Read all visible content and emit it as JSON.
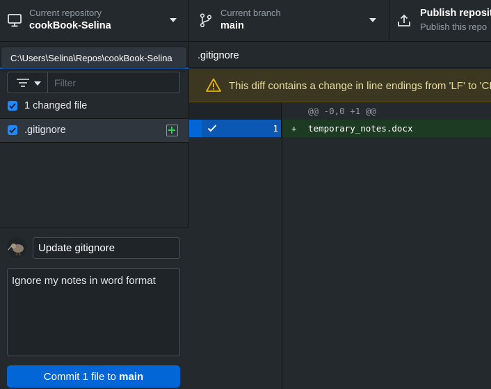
{
  "toolbar": {
    "repository": {
      "sub_label": "Current repository",
      "name": "cookBook-Selina"
    },
    "branch": {
      "sub_label": "Current branch",
      "name": "main"
    },
    "publish": {
      "title": "Publish reposit",
      "description": "Publish this repo"
    }
  },
  "tooltip": {
    "path": "C:\\Users\\Selina\\Repos\\cookBook-Selina"
  },
  "filter": {
    "placeholder": "Filter",
    "value": ""
  },
  "changes": {
    "header_label": "1 changed file",
    "files": [
      {
        "name": ".gitignore",
        "status": "added"
      }
    ]
  },
  "commit": {
    "summary": "Update gitignore",
    "description": "Ignore my notes in word format",
    "button_prefix": "Commit 1 file to ",
    "button_branch": "main"
  },
  "diff": {
    "filename": ".gitignore",
    "warning": "This diff contains a change in line endings from 'LF' to 'CR",
    "hunk_header": "@@ -0,0 +1 @@",
    "lines": [
      {
        "number": "1",
        "sign": "+",
        "text": "temporary_notes.docx"
      }
    ]
  },
  "colors": {
    "accent": "#0366d6",
    "added_green": "#34d058",
    "warning_yellow": "#e9b40e"
  }
}
